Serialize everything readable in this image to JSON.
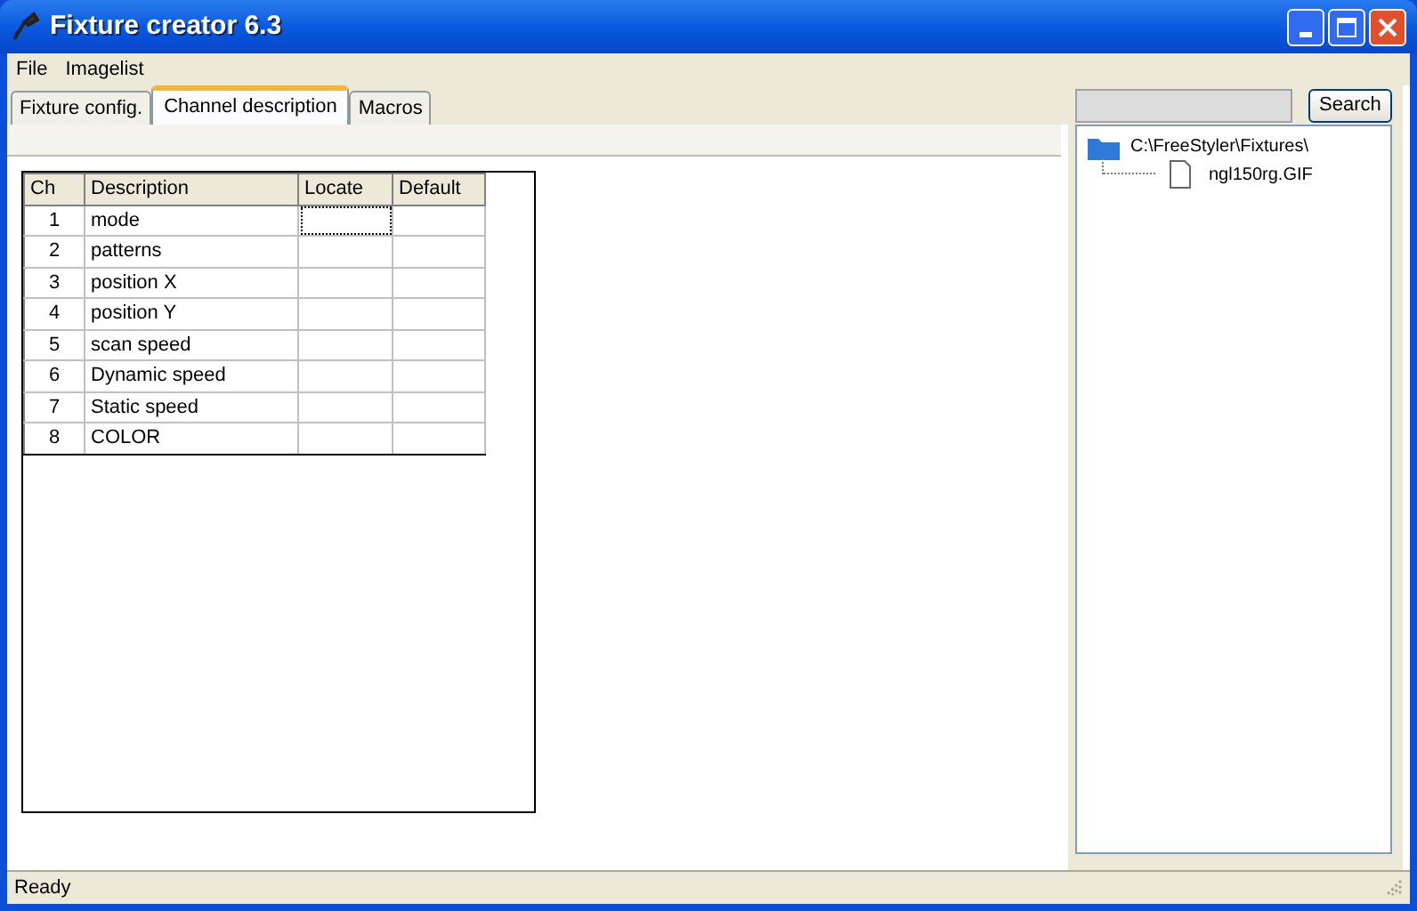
{
  "window": {
    "title": "Fixture creator 6.3"
  },
  "menu": [
    "File",
    "Imagelist"
  ],
  "tabs": [
    {
      "label": "Fixture config.",
      "selected": false
    },
    {
      "label": "Channel description",
      "selected": true
    },
    {
      "label": "Macros",
      "selected": false
    }
  ],
  "table": {
    "columns": [
      "Ch",
      "Description",
      "Locate",
      "Default"
    ],
    "rows": [
      {
        "ch": "1",
        "description": "mode",
        "focused": true
      },
      {
        "ch": "2",
        "description": "patterns",
        "focused": false
      },
      {
        "ch": "3",
        "description": "position X",
        "focused": false
      },
      {
        "ch": "4",
        "description": "position Y",
        "focused": false
      },
      {
        "ch": "5",
        "description": "scan speed",
        "focused": false
      },
      {
        "ch": "6",
        "description": "Dynamic speed",
        "focused": false
      },
      {
        "ch": "7",
        "description": "Static speed",
        "focused": false
      },
      {
        "ch": "8",
        "description": "COLOR",
        "focused": false
      }
    ]
  },
  "search_button": "Search",
  "tree": {
    "label": "C:\\FreeStyler\\Fixtures\\",
    "expanded": true,
    "children": [
      {
        "label": "ngl150rg.GIF"
      }
    ]
  },
  "status_bar": "Ready"
}
